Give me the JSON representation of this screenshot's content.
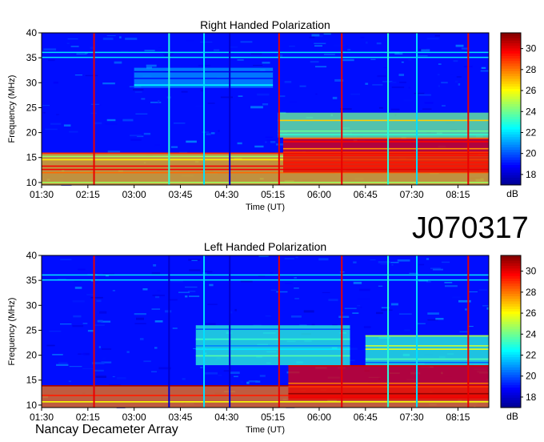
{
  "source_id": "J070317",
  "footer_text": "Nancay Decameter Array",
  "colorbar_unit": "dB",
  "colorbar_ticks": [
    18,
    20,
    22,
    24,
    26,
    28,
    30
  ],
  "colorbar_range": [
    17,
    31.5
  ],
  "colors": {
    "scale": [
      "#00008f",
      "#0000ff",
      "#0080ff",
      "#00ffff",
      "#80ff80",
      "#ffff00",
      "#ff8000",
      "#ff0000",
      "#800000"
    ],
    "panel_border": "#000000"
  },
  "chart_data": [
    {
      "type": "heatmap",
      "title": "Right Handed Polarization",
      "xlabel": "Time (UT)",
      "ylabel": "Frequency (MHz)",
      "xlim": [
        "01:30",
        "08:45"
      ],
      "ylim": [
        9.5,
        40
      ],
      "x_ticks": [
        "01:30",
        "02:15",
        "03:00",
        "03:45",
        "04:30",
        "05:15",
        "06:00",
        "06:45",
        "07:30",
        "08:15"
      ],
      "y_ticks": [
        10,
        15,
        20,
        25,
        30,
        35,
        40
      ],
      "value_unit": "dB",
      "value_range": [
        17,
        31.5
      ],
      "background_level_db": 19,
      "vertical_lines": [
        {
          "time": "02:21",
          "level_db": 30
        },
        {
          "time": "03:34",
          "level_db": 23
        },
        {
          "time": "04:08",
          "level_db": 22
        },
        {
          "time": "04:33",
          "level_db": 18
        },
        {
          "time": "05:21",
          "level_db": 30
        },
        {
          "time": "06:22",
          "level_db": 30
        },
        {
          "time": "07:07",
          "level_db": 23
        },
        {
          "time": "07:35",
          "level_db": 22
        },
        {
          "time": "08:25",
          "level_db": 30
        }
      ],
      "emission_regions": [
        {
          "t_start": "01:30",
          "t_end": "08:45",
          "f_low": 9.5,
          "f_high": 16,
          "level_db": 27
        },
        {
          "t_start": "05:25",
          "t_end": "08:45",
          "f_low": 12,
          "f_high": 19,
          "level_db": 30
        },
        {
          "t_start": "05:20",
          "t_end": "08:45",
          "f_low": 19,
          "f_high": 24,
          "level_db": 24
        },
        {
          "t_start": "03:00",
          "t_end": "05:15",
          "f_low": 29,
          "f_high": 33,
          "level_db": 21
        }
      ]
    },
    {
      "type": "heatmap",
      "title": "Left Handed Polarization",
      "xlabel": "Time (UT)",
      "ylabel": "Frequency (MHz)",
      "xlim": [
        "01:30",
        "08:45"
      ],
      "ylim": [
        9.5,
        40
      ],
      "x_ticks": [
        "01:30",
        "02:15",
        "03:00",
        "03:45",
        "04:30",
        "05:15",
        "06:00",
        "06:45",
        "07:30",
        "08:15"
      ],
      "y_ticks": [
        10,
        15,
        20,
        25,
        30,
        35,
        40
      ],
      "value_unit": "dB",
      "value_range": [
        17,
        31.5
      ],
      "background_level_db": 19,
      "vertical_lines": [
        {
          "time": "02:21",
          "level_db": 30
        },
        {
          "time": "03:34",
          "level_db": 18
        },
        {
          "time": "04:08",
          "level_db": 22
        },
        {
          "time": "04:33",
          "level_db": 18
        },
        {
          "time": "05:21",
          "level_db": 30
        },
        {
          "time": "06:22",
          "level_db": 30
        },
        {
          "time": "07:07",
          "level_db": 23
        },
        {
          "time": "07:35",
          "level_db": 22
        },
        {
          "time": "08:25",
          "level_db": 30
        }
      ],
      "emission_regions": [
        {
          "t_start": "01:30",
          "t_end": "08:45",
          "f_low": 9.5,
          "f_high": 14,
          "level_db": 28
        },
        {
          "t_start": "05:30",
          "t_end": "08:45",
          "f_low": 11,
          "f_high": 18,
          "level_db": 30
        },
        {
          "t_start": "04:00",
          "t_end": "06:30",
          "f_low": 18,
          "f_high": 26,
          "level_db": 23
        },
        {
          "t_start": "06:45",
          "t_end": "08:45",
          "f_low": 18,
          "f_high": 24,
          "level_db": 23
        }
      ]
    }
  ]
}
